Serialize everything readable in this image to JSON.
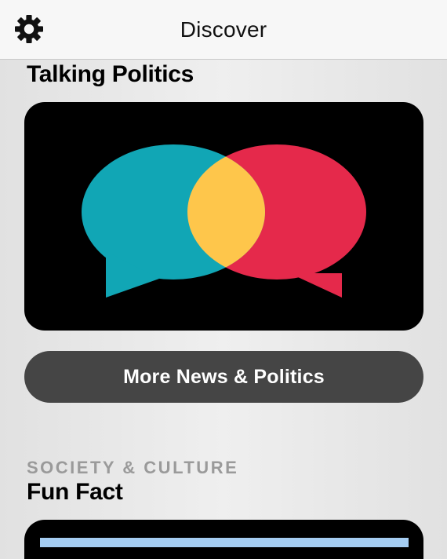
{
  "nav": {
    "title": "Discover",
    "settings_icon": "gear-icon"
  },
  "featured": {
    "title": "Talking Politics",
    "artwork_icon": "overlapping-speech-bubbles-icon",
    "colors": {
      "left_bubble": "#11a6b5",
      "right_bubble": "#e5294b",
      "overlap": "#fec64b",
      "background": "#000000"
    }
  },
  "more_button": {
    "label": "More News & Politics"
  },
  "next_section": {
    "category": "SOCIETY & CULTURE",
    "title": "Fun Fact",
    "bar_color": "#a5cdf2"
  }
}
